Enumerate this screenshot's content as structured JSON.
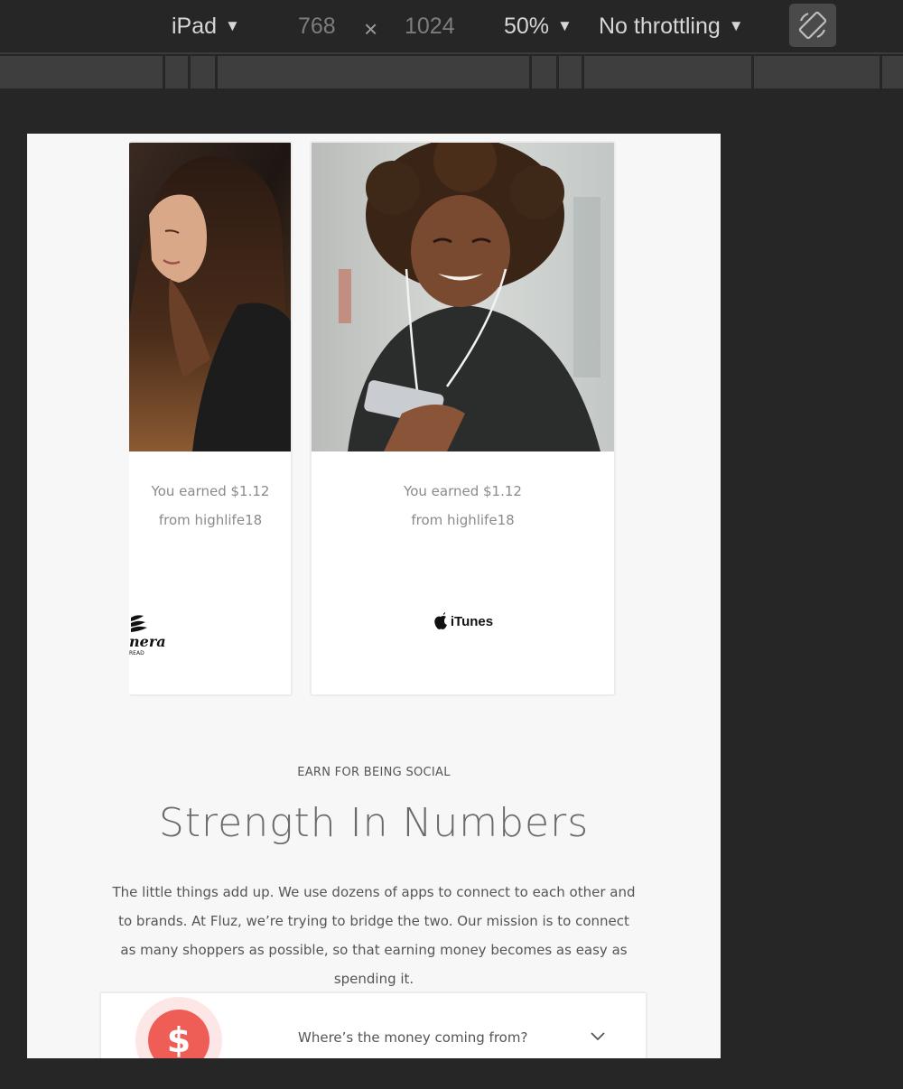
{
  "toolbar": {
    "device": "iPad",
    "width": "768",
    "height": "1024",
    "times": "×",
    "zoom": "50%",
    "throttle": "No throttling",
    "dropdown_arrow": "▼"
  },
  "icons": [
    "chevron-down-icon",
    "rotate-icon",
    "dollar-icon",
    "apple-icon",
    "panera-logo"
  ],
  "cards": [
    {
      "earned": "You earned $1.12",
      "from": "from highlife18",
      "brand": "Panera Bread"
    },
    {
      "earned": "You earned $1.12",
      "from": "from highlife18",
      "brand": "iTunes"
    }
  ],
  "section": {
    "eyebrow": "EARN FOR BEING SOCIAL",
    "title": "Strength In Numbers",
    "body": "The little things add up. We use dozens of apps to connect to each other and to brands. At Fluz, we’re trying to bridge the two. Our mission is to connect as many shoppers as possible, so that earning money becomes as easy as spending it."
  },
  "faq": {
    "question": "Where’s the money coming from?",
    "icon_symbol": "$"
  },
  "colors": {
    "accent": "#ee5d56",
    "page_bg": "#f7f7f7",
    "devtools_bg": "#262626"
  }
}
